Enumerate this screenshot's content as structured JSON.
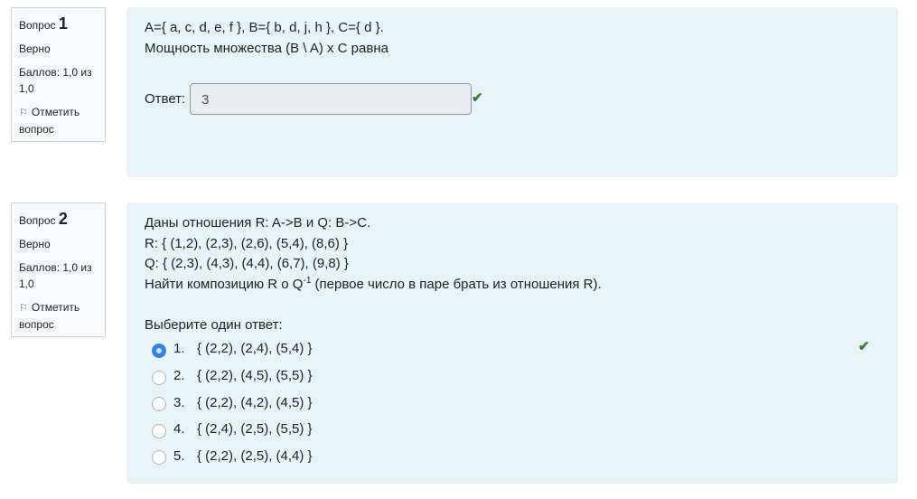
{
  "questions": [
    {
      "label": "Вопрос",
      "number": "1",
      "status": "Верно",
      "score": "Баллов: 1,0 из 1,0",
      "flag": "Отметить вопрос",
      "lines": [
        "A={ a, c, d, e, f }, B={ b, d, j, h }, C={ d }.",
        "Мощность множества (B \\ A) x C равна"
      ],
      "answer_label": "Ответ:",
      "answer_value": "3"
    },
    {
      "label": "Вопрос",
      "number": "2",
      "status": "Верно",
      "score": "Баллов: 1,0 из 1,0",
      "flag": "Отметить вопрос",
      "lines": [
        "Даны отношения R: A->B  и  Q: B->C.",
        "R: { (1,2), (2,3), (2,6), (5,4), (8,6) }",
        "Q: { (2,3), (4,3), (4,4), (6,7), (9,8) }"
      ],
      "task_pre": "Найти композицию R o Q",
      "task_sup": "-1",
      "task_post": " (первое число в паре брать из отношения R).",
      "prompt": "Выберите один ответ:",
      "options": [
        {
          "num": "1.",
          "text": "{ (2,2), (2,4), (5,4) }",
          "selected": true
        },
        {
          "num": "2.",
          "text": "{ (2,2), (4,5), (5,5) }",
          "selected": false
        },
        {
          "num": "3.",
          "text": "{ (2,2), (4,2), (4,5) }",
          "selected": false
        },
        {
          "num": "4.",
          "text": "{ (2,4), (2,5), (5,5) }",
          "selected": false
        },
        {
          "num": "5.",
          "text": "{ (2,2), (2,5), (4,4) }",
          "selected": false
        }
      ]
    }
  ],
  "colors": {
    "content_bg": "#e7f3f5",
    "correct": "#357a32",
    "radio_selected": "#3584e4"
  }
}
